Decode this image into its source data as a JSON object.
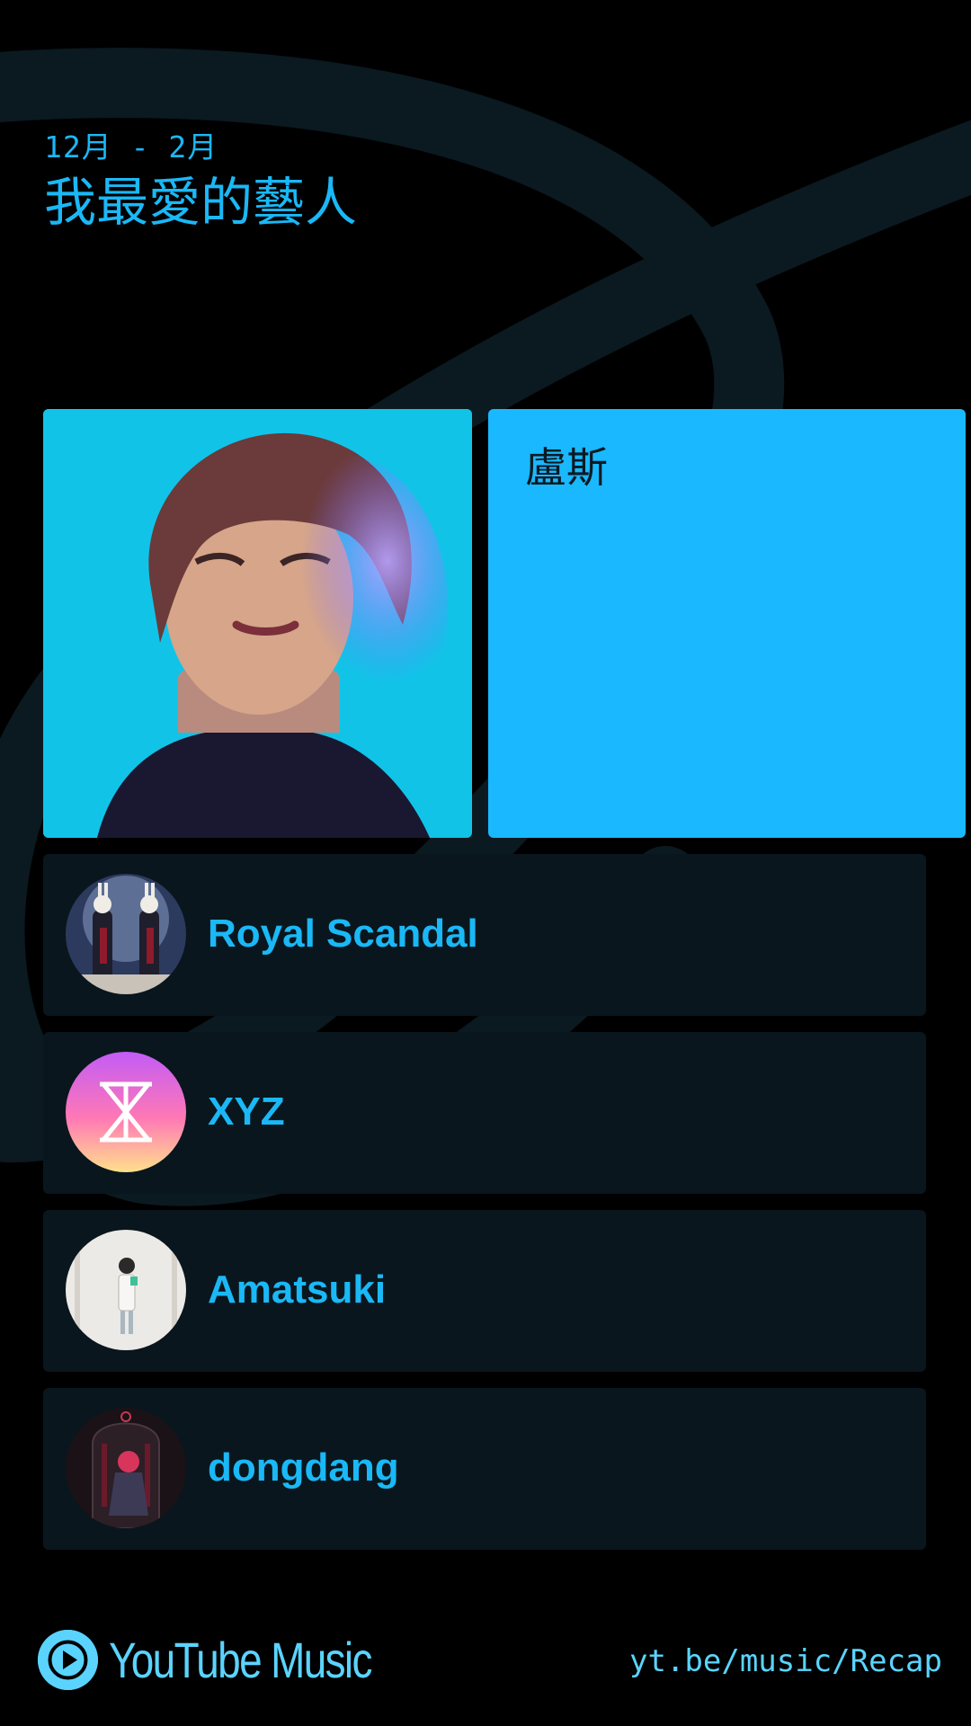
{
  "header": {
    "date_range": "12月 - 2月",
    "title": "我最愛的藝人"
  },
  "top_artist": {
    "name": "盧斯"
  },
  "ranked_artists": [
    {
      "name": "Royal Scandal"
    },
    {
      "name": "XYZ"
    },
    {
      "name": "Amatsuki"
    },
    {
      "name": "dongdang"
    }
  ],
  "footer": {
    "brand": "YouTube Music",
    "url": "yt.be/music/Recap"
  },
  "colors": {
    "accent": "#1ab8f6",
    "background": "#000000",
    "row_background": "#0a161d",
    "top_card": "#1ab8ff",
    "brand": "#5ad4ff"
  },
  "icons": {
    "brand_logo": "play-circle-icon"
  }
}
